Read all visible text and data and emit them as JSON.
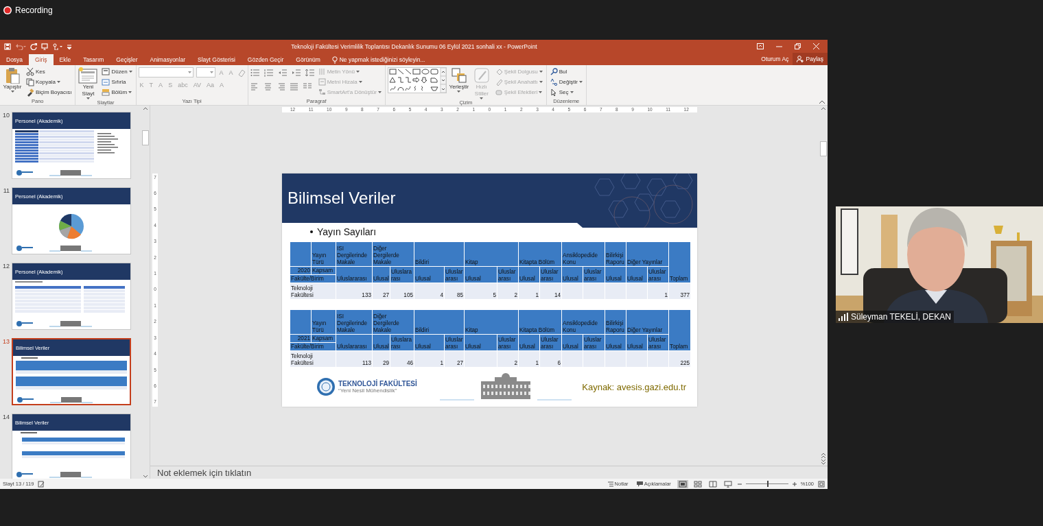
{
  "recording": {
    "label": "Recording"
  },
  "window": {
    "title": "Teknoloji Fakültesi Verimlilik Toplantısı Dekanlık Sunumu 06 Eylül 2021 sonhali xx - PowerPoint"
  },
  "tabs": [
    {
      "label": "Dosya",
      "selected": false
    },
    {
      "label": "Giriş",
      "selected": true
    },
    {
      "label": "Ekle",
      "selected": false
    },
    {
      "label": "Tasarım",
      "selected": false
    },
    {
      "label": "Geçişler",
      "selected": false
    },
    {
      "label": "Animasyonlar",
      "selected": false
    },
    {
      "label": "Slayt Gösterisi",
      "selected": false
    },
    {
      "label": "Gözden Geçir",
      "selected": false
    },
    {
      "label": "Görünüm",
      "selected": false
    }
  ],
  "tell_me": {
    "label": "Ne yapmak istediğinizi söyleyin..."
  },
  "account": {
    "sign_in": "Oturum Aç",
    "share": "Paylaş"
  },
  "ribbon": {
    "groups": [
      {
        "title": "Pano",
        "kind": "buttons",
        "items": [
          {
            "kind": "large",
            "label": "Yapıştır",
            "menu": true
          },
          {
            "kind": "small",
            "label": "Kes"
          },
          {
            "kind": "small",
            "label": "Kopyala",
            "menu": true
          },
          {
            "kind": "small",
            "label": "Biçim Boyacısı"
          }
        ]
      },
      {
        "title": "Slaytlar",
        "kind": "buttons",
        "items": [
          {
            "kind": "large",
            "label": "Yeni Slayt",
            "menu": true
          },
          {
            "kind": "small",
            "label": "Düzen",
            "menu": true
          },
          {
            "kind": "small",
            "label": "Sıfırla"
          },
          {
            "kind": "small",
            "label": "Bölüm",
            "menu": true
          }
        ]
      },
      {
        "title": "Yazı Tipi",
        "kind": "font",
        "top_controls": [
          {
            "kind": "combo"
          },
          {
            "kind": "combo"
          },
          {
            "kind": "glyph",
            "label": "A",
            "disabled": true
          },
          {
            "kind": "glyph",
            "label": "A",
            "disabled": true
          },
          {
            "kind": "icon"
          }
        ],
        "format_buttons": [
          {
            "kind": "glyph",
            "label": "K",
            "disabled": true
          },
          {
            "kind": "glyph",
            "label": "T",
            "disabled": true
          },
          {
            "kind": "glyph",
            "label": "A",
            "disabled": true
          },
          {
            "kind": "glyph",
            "label": "S",
            "disabled": true
          },
          {
            "kind": "glyph",
            "label": "abc",
            "disabled": true
          },
          {
            "kind": "glyph",
            "label": "AV",
            "disabled": true
          },
          {
            "kind": "glyph",
            "label": "Aa",
            "disabled": true
          },
          {
            "kind": "glyph",
            "label": "A",
            "disabled": true
          }
        ]
      },
      {
        "title": "Paragraf",
        "kind": "buttons",
        "items": [
          {
            "kind": "icons"
          },
          {
            "kind": "small",
            "label": "Metin Yönü",
            "menu": true,
            "disabled": true
          },
          {
            "kind": "small",
            "label": "Metni Hizala",
            "menu": true,
            "disabled": true
          },
          {
            "kind": "small",
            "label": "SmartArt'a Dönüştür",
            "menu": true,
            "disabled": true
          }
        ]
      },
      {
        "title": "Çizim",
        "kind": "buttons",
        "items": [
          {
            "kind": "gallery"
          },
          {
            "kind": "large",
            "label": "Yerleştir",
            "menu": true
          },
          {
            "kind": "large",
            "label": "Hızlı Stiller",
            "menu": true,
            "disabled": true
          },
          {
            "kind": "small",
            "label": "Şekil Dolgusu",
            "menu": true,
            "disabled": true
          },
          {
            "kind": "small",
            "label": "Şekil Anahattı",
            "menu": true,
            "disabled": true
          },
          {
            "kind": "small",
            "label": "Şekil Efektleri",
            "menu": true,
            "disabled": true
          }
        ]
      },
      {
        "title": "Düzenleme",
        "kind": "buttons",
        "items": [
          {
            "kind": "small",
            "label": "Bul"
          },
          {
            "kind": "small",
            "label": "Değiştir",
            "menu": true
          },
          {
            "kind": "small",
            "label": "Seç",
            "menu": true
          }
        ]
      }
    ]
  },
  "slides": [
    {
      "number": "10",
      "title": "Personel (Akademik)",
      "kind": "table",
      "selected": false
    },
    {
      "number": "11",
      "title": "Personel (Akademik)",
      "kind": "pie",
      "selected": false
    },
    {
      "number": "12",
      "title": "Personel (Akademik)",
      "kind": "tables",
      "selected": false
    },
    {
      "number": "13",
      "title": "Bilimsel Veriler",
      "kind": "yayin",
      "selected": true
    },
    {
      "number": "14",
      "title": "Bilimsel Veriler",
      "kind": "atif",
      "selected": false
    }
  ],
  "h_ruler": [
    "12",
    "11",
    "10",
    "9",
    "8",
    "7",
    "6",
    "5",
    "4",
    "3",
    "2",
    "1",
    "0",
    "1",
    "2",
    "3",
    "4",
    "5",
    "6",
    "7",
    "8",
    "9",
    "10",
    "11",
    "12"
  ],
  "v_ruler": [
    "7",
    "6",
    "5",
    "4",
    "3",
    "2",
    "1",
    "0",
    "1",
    "2",
    "3",
    "4",
    "5",
    "6",
    "7"
  ],
  "slide": {
    "title": "Bilimsel Veriler",
    "bullet": "Yayın Sayıları",
    "tables": [
      {
        "year": "2020",
        "type_label": "Yayın Türü",
        "scope_label": "Kapsam",
        "unit_label": "Fakülte/Birim",
        "total_label": "Toplam",
        "groups": [
          {
            "label": "ISI Dergilerinde Makale",
            "columns": [
              "Uluslararası"
            ]
          },
          {
            "label": "Diğer Dergilerde Makale",
            "columns": [
              "Ulusal",
              "Uluslararası"
            ]
          },
          {
            "label": "Bildiri",
            "columns": [
              "Ulusal",
              "Uluslararası"
            ]
          },
          {
            "label": "Kitap",
            "columns": [
              "Ulusal",
              "Uluslararası"
            ]
          },
          {
            "label": "Kitapta Bölüm",
            "columns": [
              "Ulusal",
              "Uluslararası"
            ]
          },
          {
            "label": "Ansiklopedide Konu",
            "columns": [
              "Ulusal",
              "Uluslararası"
            ]
          },
          {
            "label": "Bilirkişi Raporu",
            "columns": [
              "Ulusal"
            ]
          },
          {
            "label": "Diğer Yayınlar",
            "columns": [
              "Ulusal",
              "Uluslararası"
            ]
          }
        ],
        "rows": [
          {
            "unit": "Teknoloji Fakültesi",
            "values": [
              {
                "kind": "value",
                "text": "133"
              },
              {
                "kind": "value",
                "text": "27"
              },
              {
                "kind": "value",
                "text": "105"
              },
              {
                "kind": "value",
                "text": "4"
              },
              {
                "kind": "value",
                "text": "85"
              },
              {
                "kind": "value",
                "text": "5"
              },
              {
                "kind": "value",
                "text": "2"
              },
              {
                "kind": "value",
                "text": "1"
              },
              {
                "kind": "value",
                "text": "14"
              },
              {
                "kind": "empty"
              },
              {
                "kind": "empty"
              },
              {
                "kind": "empty"
              },
              {
                "kind": "empty"
              },
              {
                "kind": "value",
                "text": "1"
              }
            ],
            "total": "377"
          }
        ]
      },
      {
        "year": "2021",
        "type_label": "Yayın Türü",
        "scope_label": "Kapsam",
        "unit_label": "Fakülte/Birim",
        "total_label": "Toplam",
        "groups": [
          {
            "label": "ISI Dergilerinde Makale",
            "columns": [
              "Uluslararası"
            ]
          },
          {
            "label": "Diğer Dergilerde Makale",
            "columns": [
              "Ulusal",
              "Uluslararası"
            ]
          },
          {
            "label": "Bildiri",
            "columns": [
              "Ulusal",
              "Uluslararası"
            ]
          },
          {
            "label": "Kitap",
            "columns": [
              "Ulusal",
              "Uluslararası"
            ]
          },
          {
            "label": "Kitapta Bölüm",
            "columns": [
              "Ulusal",
              "Uluslararası"
            ]
          },
          {
            "label": "Ansiklopedide Konu",
            "columns": [
              "Ulusal",
              "Uluslararası"
            ]
          },
          {
            "label": "Bilirkişi Raporu",
            "columns": [
              "Ulusal"
            ]
          },
          {
            "label": "Diğer Yayınlar",
            "columns": [
              "Ulusal",
              "Uluslararası"
            ]
          }
        ],
        "rows": [
          {
            "unit": "Teknoloji Fakültesi",
            "values": [
              {
                "kind": "value",
                "text": "113"
              },
              {
                "kind": "value",
                "text": "29"
              },
              {
                "kind": "value",
                "text": "46"
              },
              {
                "kind": "value",
                "text": "1"
              },
              {
                "kind": "value",
                "text": "27"
              },
              {
                "kind": "empty"
              },
              {
                "kind": "value",
                "text": "2"
              },
              {
                "kind": "value",
                "text": "1"
              },
              {
                "kind": "value",
                "text": "6"
              },
              {
                "kind": "empty"
              },
              {
                "kind": "empty"
              },
              {
                "kind": "empty"
              },
              {
                "kind": "empty"
              },
              {
                "kind": "empty"
              }
            ],
            "total": "225"
          }
        ]
      }
    ],
    "logo": {
      "name": "TEKNOLOJİ FAKÜLTESİ",
      "motto": "“Yeni Nesil Mühendislik”"
    },
    "source": "Kaynak: avesis.gazi.edu.tr"
  },
  "notes": {
    "placeholder": "Not eklemek için tıklatın"
  },
  "status_bar": {
    "slide": "Slayt 13 / 119",
    "notes": "Notlar",
    "comments": "Açıklamalar",
    "views": [
      {
        "selected": true
      },
      {
        "selected": false
      },
      {
        "selected": false
      },
      {
        "selected": false
      }
    ],
    "zoom": {
      "level": 0.5
    },
    "zoom_label": "%100"
  },
  "video": {
    "name": "Süleyman TEKELİ, DEKAN"
  }
}
